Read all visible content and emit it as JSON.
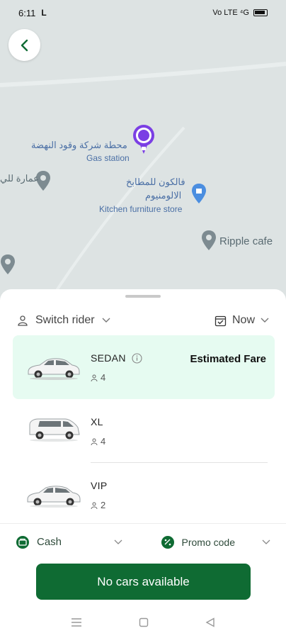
{
  "status_bar": {
    "time": "6:11",
    "left_icon": "L",
    "signal_text": "Vo LTE ⁴G"
  },
  "map": {
    "back_icon": "chevron-left-icon",
    "pois": {
      "gas_station_ar": "محطة شركة وقود النهضة",
      "gas_station_en": "Gas station",
      "building_ar": "عمارة للي",
      "kitchen_ar_line1": "فالكون للمطابخ",
      "kitchen_ar_line2": "الالومنيوم",
      "kitchen_en": "Kitchen furniture store",
      "ripple_cafe": "Ripple cafe"
    }
  },
  "sheet": {
    "switch_rider_label": "Switch rider",
    "schedule_label": "Now",
    "cars": [
      {
        "name": "SEDAN",
        "seats": "4",
        "selected": true,
        "estimated_fare_label": "Estimated Fare"
      },
      {
        "name": "XL",
        "seats": "4",
        "selected": false
      },
      {
        "name": "VIP",
        "seats": "2",
        "selected": false
      }
    ],
    "payment_label": "Cash",
    "promo_label": "Promo code",
    "cta_label": "No cars available"
  },
  "colors": {
    "brand_green": "#0f6b33",
    "selected_bg": "#e6fbf1",
    "marker_purple": "#7b3fe4",
    "map_bg": "#dde3e3"
  }
}
